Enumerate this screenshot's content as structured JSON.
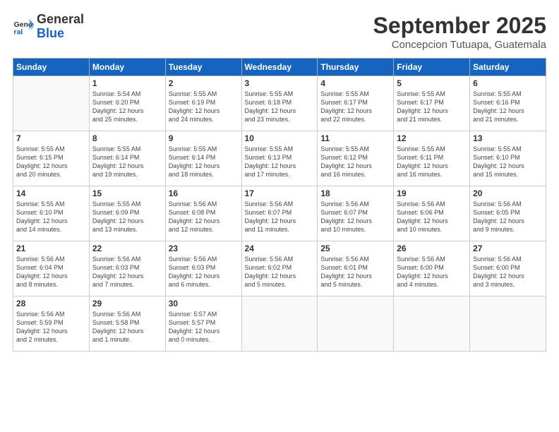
{
  "logo": {
    "line1": "General",
    "line2": "Blue"
  },
  "title": "September 2025",
  "location": "Concepcion Tutuapa, Guatemala",
  "days_of_week": [
    "Sunday",
    "Monday",
    "Tuesday",
    "Wednesday",
    "Thursday",
    "Friday",
    "Saturday"
  ],
  "weeks": [
    [
      {
        "day": "",
        "empty": true
      },
      {
        "day": "1",
        "sunrise": "5:54 AM",
        "sunset": "6:20 PM",
        "daylight": "12 hours and 25 minutes."
      },
      {
        "day": "2",
        "sunrise": "5:55 AM",
        "sunset": "6:19 PM",
        "daylight": "12 hours and 24 minutes."
      },
      {
        "day": "3",
        "sunrise": "5:55 AM",
        "sunset": "6:18 PM",
        "daylight": "12 hours and 23 minutes."
      },
      {
        "day": "4",
        "sunrise": "5:55 AM",
        "sunset": "6:17 PM",
        "daylight": "12 hours and 22 minutes."
      },
      {
        "day": "5",
        "sunrise": "5:55 AM",
        "sunset": "6:17 PM",
        "daylight": "12 hours and 21 minutes."
      },
      {
        "day": "6",
        "sunrise": "5:55 AM",
        "sunset": "6:16 PM",
        "daylight": "12 hours and 21 minutes."
      }
    ],
    [
      {
        "day": "7",
        "sunrise": "5:55 AM",
        "sunset": "6:15 PM",
        "daylight": "12 hours and 20 minutes."
      },
      {
        "day": "8",
        "sunrise": "5:55 AM",
        "sunset": "6:14 PM",
        "daylight": "12 hours and 19 minutes."
      },
      {
        "day": "9",
        "sunrise": "5:55 AM",
        "sunset": "6:14 PM",
        "daylight": "12 hours and 18 minutes."
      },
      {
        "day": "10",
        "sunrise": "5:55 AM",
        "sunset": "6:13 PM",
        "daylight": "12 hours and 17 minutes."
      },
      {
        "day": "11",
        "sunrise": "5:55 AM",
        "sunset": "6:12 PM",
        "daylight": "12 hours and 16 minutes."
      },
      {
        "day": "12",
        "sunrise": "5:55 AM",
        "sunset": "6:11 PM",
        "daylight": "12 hours and 16 minutes."
      },
      {
        "day": "13",
        "sunrise": "5:55 AM",
        "sunset": "6:10 PM",
        "daylight": "12 hours and 15 minutes."
      }
    ],
    [
      {
        "day": "14",
        "sunrise": "5:55 AM",
        "sunset": "6:10 PM",
        "daylight": "12 hours and 14 minutes."
      },
      {
        "day": "15",
        "sunrise": "5:55 AM",
        "sunset": "6:09 PM",
        "daylight": "12 hours and 13 minutes."
      },
      {
        "day": "16",
        "sunrise": "5:56 AM",
        "sunset": "6:08 PM",
        "daylight": "12 hours and 12 minutes."
      },
      {
        "day": "17",
        "sunrise": "5:56 AM",
        "sunset": "6:07 PM",
        "daylight": "12 hours and 11 minutes."
      },
      {
        "day": "18",
        "sunrise": "5:56 AM",
        "sunset": "6:07 PM",
        "daylight": "12 hours and 10 minutes."
      },
      {
        "day": "19",
        "sunrise": "5:56 AM",
        "sunset": "6:06 PM",
        "daylight": "12 hours and 10 minutes."
      },
      {
        "day": "20",
        "sunrise": "5:56 AM",
        "sunset": "6:05 PM",
        "daylight": "12 hours and 9 minutes."
      }
    ],
    [
      {
        "day": "21",
        "sunrise": "5:56 AM",
        "sunset": "6:04 PM",
        "daylight": "12 hours and 8 minutes."
      },
      {
        "day": "22",
        "sunrise": "5:56 AM",
        "sunset": "6:03 PM",
        "daylight": "12 hours and 7 minutes."
      },
      {
        "day": "23",
        "sunrise": "5:56 AM",
        "sunset": "6:03 PM",
        "daylight": "12 hours and 6 minutes."
      },
      {
        "day": "24",
        "sunrise": "5:56 AM",
        "sunset": "6:02 PM",
        "daylight": "12 hours and 5 minutes."
      },
      {
        "day": "25",
        "sunrise": "5:56 AM",
        "sunset": "6:01 PM",
        "daylight": "12 hours and 5 minutes."
      },
      {
        "day": "26",
        "sunrise": "5:56 AM",
        "sunset": "6:00 PM",
        "daylight": "12 hours and 4 minutes."
      },
      {
        "day": "27",
        "sunrise": "5:56 AM",
        "sunset": "6:00 PM",
        "daylight": "12 hours and 3 minutes."
      }
    ],
    [
      {
        "day": "28",
        "sunrise": "5:56 AM",
        "sunset": "5:59 PM",
        "daylight": "12 hours and 2 minutes."
      },
      {
        "day": "29",
        "sunrise": "5:56 AM",
        "sunset": "5:58 PM",
        "daylight": "12 hours and 1 minute."
      },
      {
        "day": "30",
        "sunrise": "5:57 AM",
        "sunset": "5:57 PM",
        "daylight": "12 hours and 0 minutes."
      },
      {
        "day": "",
        "empty": true
      },
      {
        "day": "",
        "empty": true
      },
      {
        "day": "",
        "empty": true
      },
      {
        "day": "",
        "empty": true
      }
    ]
  ]
}
